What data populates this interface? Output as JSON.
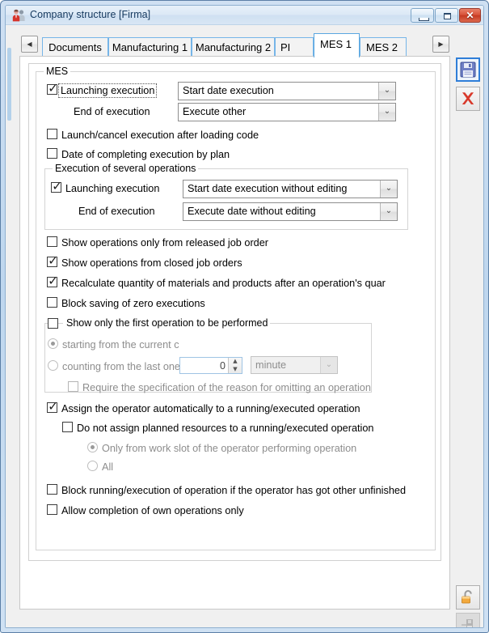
{
  "window": {
    "title": "Company structure [Firma]",
    "icon": "people-icon",
    "controls": {
      "minimize": "minimize-icon",
      "maximize": "maximize-icon",
      "close": "✕"
    }
  },
  "tabs": {
    "scroll_left": "◀",
    "scroll_right": "▶",
    "items": [
      {
        "label": "Documents",
        "active": false
      },
      {
        "label": "Manufacturing 1",
        "active": false
      },
      {
        "label": "Manufacturing 2",
        "active": false
      },
      {
        "label": "PI",
        "active": false
      },
      {
        "label": "MES 1",
        "active": true
      },
      {
        "label": "MES 2",
        "active": false
      }
    ]
  },
  "form": {
    "mes_group": {
      "title": "MES",
      "launching_execution": {
        "label": "Launching execution",
        "checked": true,
        "combo_value": "Start date execution"
      },
      "end_of_execution": {
        "label": "End of execution",
        "combo_value": "Execute other"
      },
      "launch_cancel_after_code": {
        "label": "Launch/cancel execution after loading code",
        "checked": false
      },
      "date_of_completing": {
        "label": "Date of completing execution by plan",
        "checked": false
      },
      "several_operations_group": {
        "title": "Execution of several operations",
        "launching_execution": {
          "label": "Launching execution",
          "checked": true,
          "combo_value": "Start date execution without editing"
        },
        "end_of_execution": {
          "label": "End of execution",
          "combo_value": "Execute date without editing"
        }
      },
      "show_released_only": {
        "label": "Show operations only from released job order",
        "checked": false
      },
      "show_closed": {
        "label": "Show operations from closed job orders",
        "checked": true
      },
      "recalculate_quantity": {
        "label": "Recalculate quantity of materials and products after an operation's quar",
        "checked": true
      },
      "block_zero_executions": {
        "label": "Block saving of zero executions",
        "checked": false
      },
      "first_operation_group": {
        "title": "Show only the first operation to be performed",
        "checked": false,
        "radio_current": {
          "label": "starting from the current c",
          "selected": true,
          "disabled": true
        },
        "radio_counting": {
          "label": "counting from the last one",
          "selected": false,
          "disabled": true
        },
        "spinner_value": "0",
        "unit_combo_value": "minute",
        "require_reason": {
          "label": "Require the specification of the reason for omitting an operation",
          "checked": false,
          "disabled": true
        }
      },
      "assign_operator": {
        "label": "Assign the operator automatically to a running/executed operation",
        "checked": true
      },
      "do_not_assign_resources": {
        "label": "Do not assign planned resources to a running/executed operation",
        "checked": false
      },
      "resource_scope_work_slot": {
        "label": "Only from work slot of the operator performing operation",
        "selected": true,
        "disabled": true
      },
      "resource_scope_all": {
        "label": "All",
        "selected": false,
        "disabled": true
      },
      "block_running_unfinished": {
        "label": "Block running/execution of operation if the operator has got other unfinished",
        "checked": false
      },
      "allow_own_operations_only": {
        "label": "Allow completion of own operations only",
        "checked": false
      }
    }
  },
  "toolbar": {
    "save": "save-floppy-icon",
    "cancel": "cancel-x-icon",
    "unlock": "padlock-open-icon",
    "pin": "pin-save-icon"
  },
  "glyphs": {
    "check": "✓",
    "chevron_down": "⌄",
    "arrow_up": "▲",
    "arrow_down": "▼"
  },
  "colors": {
    "window_frame": "#bed6ee",
    "tab_border": "#76b5e8",
    "close_button": "#c63a22",
    "disabled_text": "#8d8d8d"
  }
}
